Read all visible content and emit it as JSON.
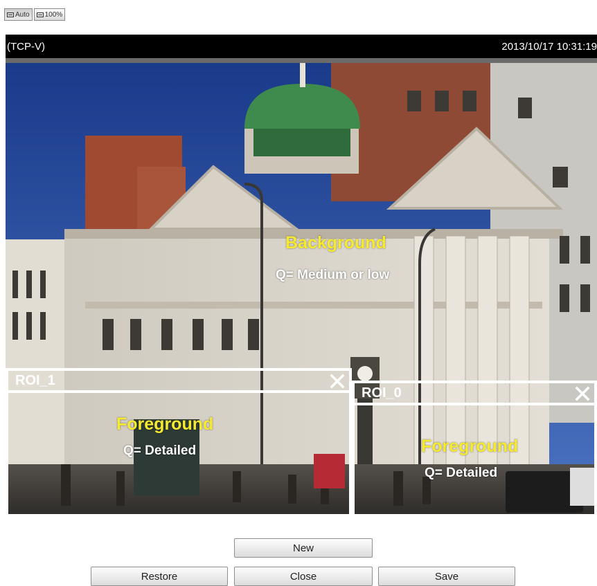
{
  "toolbar": {
    "auto_label": "Auto",
    "full_label": "100%"
  },
  "viewer": {
    "protocol": "(TCP-V)",
    "timestamp": "2013/10/17 10:31:19"
  },
  "background_region": {
    "title": "Background",
    "quality": "Q= Medium or low"
  },
  "rois": [
    {
      "name": "ROI_1",
      "title": "Foreground",
      "quality": "Q= Detailed"
    },
    {
      "name": "ROI_0",
      "title": "Foreground",
      "quality": "Q= Detailed"
    }
  ],
  "buttons": {
    "new": "New",
    "restore": "Restore",
    "close": "Close",
    "save": "Save"
  },
  "colors": {
    "label_accent": "#f5ea30",
    "roi_border": "#ffffff",
    "osd_bar": "#000000"
  },
  "icons": {
    "zoom_auto": "fit-window-icon",
    "zoom_full": "actual-size-icon",
    "roi_close": "close-icon"
  }
}
